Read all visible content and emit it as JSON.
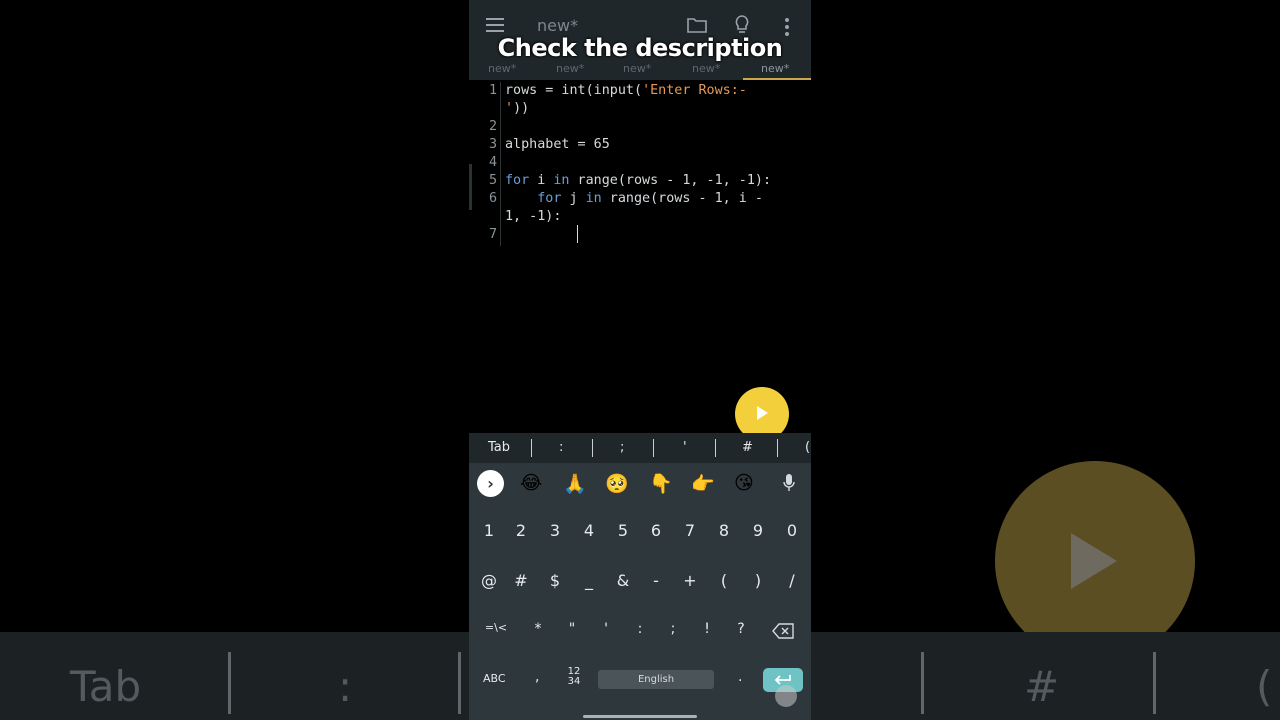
{
  "app": {
    "title": "new*",
    "overlay_caption": "Check the description",
    "tabs": [
      "new*",
      "new*",
      "new*",
      "new*",
      "new*"
    ],
    "active_tab_index": 4
  },
  "editor": {
    "line_numbers": [
      "1",
      "2",
      "3",
      "4",
      "5",
      "6",
      "7"
    ],
    "lines": [
      {
        "parts": [
          {
            "t": "rows = int(input(",
            "c": "plain"
          },
          {
            "t": "'Enter Rows:-",
            "c": "str"
          }
        ]
      },
      {
        "parts": [
          {
            "t": "'",
            "c": "str"
          },
          {
            "t": "))",
            "c": "plain"
          }
        ]
      },
      {
        "parts": []
      },
      {
        "parts": [
          {
            "t": "alphabet = 65",
            "c": "plain"
          }
        ]
      },
      {
        "parts": []
      },
      {
        "parts": [
          {
            "t": "for",
            "c": "kw"
          },
          {
            "t": " i ",
            "c": "plain"
          },
          {
            "t": "in",
            "c": "kw"
          },
          {
            "t": " range(rows - 1, -1, -1):",
            "c": "plain"
          }
        ]
      },
      {
        "parts": [
          {
            "t": "    ",
            "c": "plain"
          },
          {
            "t": "for",
            "c": "kw"
          },
          {
            "t": " j ",
            "c": "plain"
          },
          {
            "t": "in",
            "c": "kw"
          },
          {
            "t": " range(rows - 1, i -",
            "c": "plain"
          }
        ]
      },
      {
        "parts": [
          {
            "t": "1, -1):",
            "c": "plain"
          }
        ]
      }
    ]
  },
  "symbol_bar": [
    "Tab",
    ":",
    ";",
    "'",
    "#",
    "("
  ],
  "keyboard": {
    "emojis": [
      "😂",
      "🙏",
      "🥺",
      "👇",
      "👉",
      "😘"
    ],
    "numbers": [
      "1",
      "2",
      "3",
      "4",
      "5",
      "6",
      "7",
      "8",
      "9",
      "0"
    ],
    "symbols_row1": [
      "@",
      "#",
      "$",
      "_",
      "&",
      "-",
      "+",
      "(",
      ")",
      "/"
    ],
    "symbols_row2": [
      "=\\<",
      "*",
      "\"",
      "'",
      ":",
      ";",
      "!",
      "?"
    ],
    "abc_label": "ABC",
    "comma": ",",
    "numpad_label_top": "12",
    "numpad_label_bottom": "34",
    "space_label": "English",
    "period": "."
  },
  "background": {
    "tab_label": "Tab",
    "colon": ":",
    "hash": "#",
    "paren": "("
  },
  "colors": {
    "accent_fab": "#f3cf3c",
    "keyword": "#6b9cd6",
    "string": "#e59a5a",
    "enter_key": "#6fc3c4"
  }
}
